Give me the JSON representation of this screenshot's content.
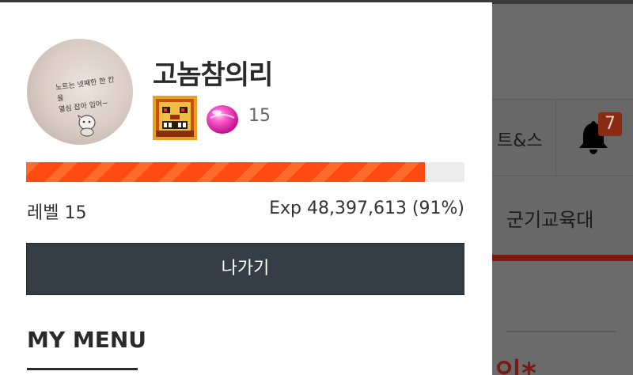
{
  "background": {
    "tab_text": "트&스",
    "notification_count": "7",
    "nav_text": "군기교육대",
    "red_text": "인*"
  },
  "profile": {
    "nickname": "고놈참의리",
    "avatar_text": "노트는 넷째한 한 칸을\n열심 잡아 입어~",
    "gem_count": "15"
  },
  "progress": {
    "level_label": "레벨 15",
    "exp_label": "Exp 48,397,613 (91%)",
    "fill_percent": 91
  },
  "actions": {
    "logout_label": "나가기"
  },
  "menu": {
    "section_title": "MY MENU"
  },
  "colors": {
    "accent": "#ff4a12",
    "button_bg": "#353d47",
    "badge": "#8a2a14"
  }
}
